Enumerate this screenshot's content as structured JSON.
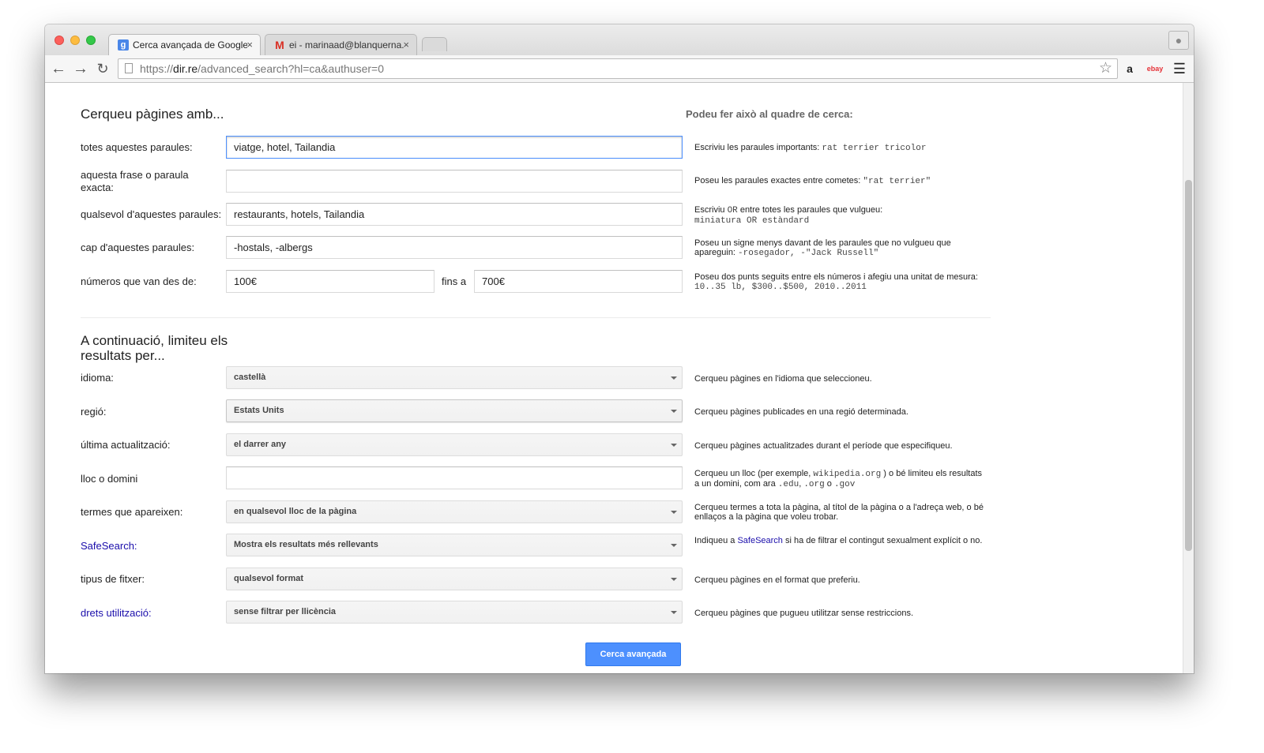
{
  "browser": {
    "tabs": [
      {
        "title": "Cerca avançada de Google",
        "close": "×",
        "favicon": "g"
      },
      {
        "title": "ei - marinaad@blanquerna.",
        "close": "×",
        "favicon": "M"
      }
    ],
    "url_scheme": "https://",
    "url_domain": "dir.re",
    "url_path": "/advanced_search?hl=ca&authuser=0",
    "ext_amazon": "a",
    "ext_ebay": "ebay"
  },
  "form": {
    "section1_title": "Cerqueu pàgines amb...",
    "help_title": "Podeu fer això al quadre de cerca:",
    "all_words": {
      "label": "totes aquestes paraules:",
      "value": "viatge, hotel, Tailandia",
      "help_text": "Escriviu les paraules importants: ",
      "help_code": "rat terrier tricolor"
    },
    "exact_phrase": {
      "label": "aquesta frase o paraula exacta:",
      "value": "",
      "help_text": "Poseu les paraules exactes entre cometes: ",
      "help_code": "\"rat terrier\""
    },
    "any_words": {
      "label": "qualsevol d'aquestes paraules:",
      "value": "restaurants, hotels, Tailandia",
      "help_a": "Escriviu ",
      "help_or": "OR",
      "help_b": " entre totes les paraules que vulgueu:",
      "help_code": "miniatura OR estàndard"
    },
    "none_words": {
      "label": "cap d'aquestes paraules:",
      "value": "-hostals, -albergs",
      "help_text": "Poseu un signe menys davant de les paraules que no vulgueu que apareguin: ",
      "help_code": "-rosegador, -\"Jack Russell\""
    },
    "numbers": {
      "label": "números que van des de:",
      "from": "100€",
      "to_label": "fins a",
      "to": "700€",
      "help_text": "Poseu dos punts seguits entre els números i afegiu una unitat de mesura:",
      "help_code": "10..35 lb, $300..$500, 2010..2011"
    },
    "section2_title": "A continuació, limiteu els resultats per...",
    "language": {
      "label": "idioma:",
      "value": "castellà",
      "help": "Cerqueu pàgines en l'idioma que seleccioneu."
    },
    "region": {
      "label": "regió:",
      "value": "Estats Units",
      "help": "Cerqueu pàgines publicades en una regió determinada."
    },
    "last_update": {
      "label": "última actualització:",
      "value": "el darrer any",
      "help": "Cerqueu pàgines actualitzades durant el període que especifiqueu."
    },
    "site": {
      "label": "lloc o domini",
      "value": "",
      "help_a": "Cerqueu un lloc (per exemple, ",
      "help_code1": "wikipedia.org",
      "help_b": " ) o bé limiteu els resultats a un domini, com ara ",
      "help_code2": ".edu",
      "help_c": ", ",
      "help_code3": ".org",
      "help_d": " o ",
      "help_code4": ".gov"
    },
    "terms": {
      "label": "termes que apareixen:",
      "value": "en qualsevol lloc de la pàgina",
      "help": "Cerqueu termes a tota la pàgina, al títol de la pàgina o a l'adreça web, o bé enllaços a la pàgina que voleu trobar."
    },
    "safesearch": {
      "label": "SafeSearch:",
      "value": "Mostra els resultats més rellevants",
      "help_a": "Indiqueu a ",
      "help_link": "SafeSearch",
      "help_b": " si ha de filtrar el contingut sexualment explícit o no."
    },
    "filetype": {
      "label": "tipus de fitxer:",
      "value": "qualsevol format",
      "help": "Cerqueu pàgines en el format que preferiu."
    },
    "rights": {
      "label": "drets utilització:",
      "value": "sense filtrar per llicència",
      "help": "Cerqueu pàgines que pugueu utilitzar sense restriccions."
    },
    "submit": "Cerca avançada"
  }
}
